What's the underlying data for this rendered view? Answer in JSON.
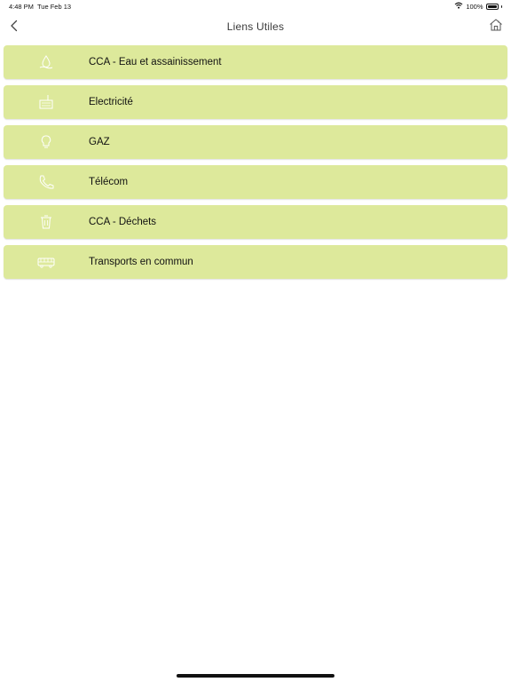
{
  "status_bar": {
    "time": "4:48 PM",
    "date": "Tue Feb 13",
    "battery": "100%",
    "battery_level": 1.0
  },
  "header": {
    "title": "Liens Utiles",
    "back_icon": "chevron-left-icon",
    "home_icon": "home-icon"
  },
  "items": [
    {
      "label": "CCA - Eau et assainissement",
      "icon": "water-drop-icon"
    },
    {
      "label": "Electricité",
      "icon": "power-meter-icon"
    },
    {
      "label": "GAZ",
      "icon": "lightbulb-icon"
    },
    {
      "label": "Télécom",
      "icon": "phone-icon"
    },
    {
      "label": "CCA - Déchets",
      "icon": "waste-bin-icon"
    },
    {
      "label": "Transports en commun",
      "icon": "bus-icon"
    }
  ],
  "colors": {
    "item_background": "#dde99b",
    "icon_stroke": "#ffffff",
    "text": "#111111"
  }
}
